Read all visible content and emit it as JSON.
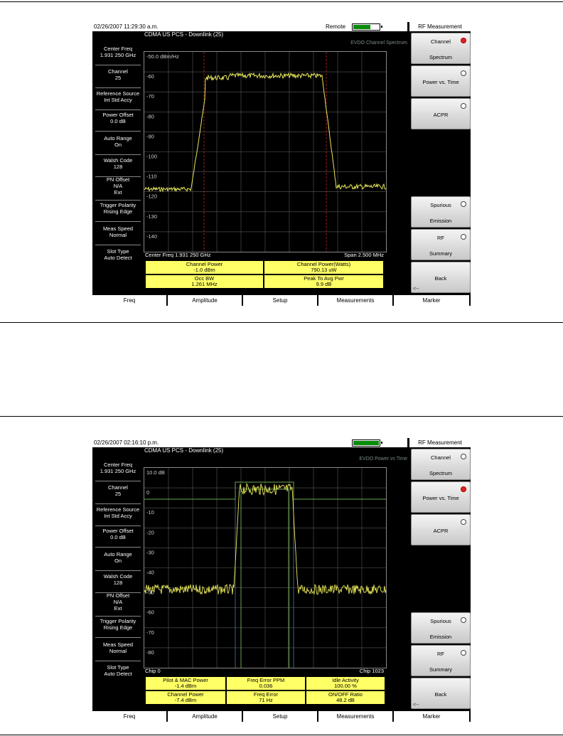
{
  "screens": [
    {
      "timestamp": "02/26/2007 11:29:30 a.m.",
      "remote_label": "Remote",
      "subtitle": "CDMA US PCS - Downlink (25)",
      "chart_title": "EVDO Channel Spectrum",
      "menu_title": "RF Measurement",
      "left_params": [
        {
          "name": "Center Freq",
          "value": "1.931 250 GHz"
        },
        {
          "name": "Channel",
          "value": "25"
        },
        {
          "name": "Reference Source",
          "value": "Int Std Accy"
        },
        {
          "name": "Power Offset",
          "value": "0.0 dB"
        },
        {
          "name": "Auto Range",
          "value": "On"
        },
        {
          "name": "Walsh Code",
          "value": "128"
        },
        {
          "name": "PN Offset",
          "value": "N/A",
          "extra": "Ext"
        },
        {
          "name": "Trigger Polarity",
          "value": "Rising Edge"
        },
        {
          "name": "Meas Speed",
          "value": "Normal"
        },
        {
          "name": "Slot Type",
          "value": "Auto Detect"
        }
      ],
      "softkeys": [
        {
          "line1": "Channel",
          "line2": "Spectrum",
          "selected": true
        },
        {
          "line1": "Power vs. Time",
          "line2": "",
          "selected": false
        },
        {
          "line1": "ACPR",
          "line2": "",
          "selected": false
        },
        {
          "line1": "Spurious",
          "line2": "Emission",
          "selected": false
        },
        {
          "line1": "RF",
          "line2": "Summary",
          "selected": false
        },
        {
          "line1": "Back",
          "line2": "",
          "selected": false
        }
      ],
      "y_labels": [
        "-50.0 dBm/Hz",
        "-60",
        "-70",
        "-80",
        "-90",
        "-100",
        "-110",
        "-120",
        "-130",
        "-140"
      ],
      "x_left": "Center Freq 1.931 250 GHz",
      "x_right": "Span 2.500 MHz",
      "results": [
        {
          "name": "Channel Power",
          "value": "-1.0 dBm"
        },
        {
          "name": "Channel Power(Watts)",
          "value": "790.13 uW"
        },
        {
          "name": "Occ BW",
          "value": "1.261 MHz"
        },
        {
          "name": "Peak To Avg Pwr",
          "value": "9.9 dB"
        }
      ],
      "bottom_tabs": [
        "Freq",
        "Amplitude",
        "Setup",
        "Measurements",
        "Marker"
      ]
    },
    {
      "timestamp": "02/26/2007 02:16:10 p.m.",
      "remote_label": "",
      "subtitle": "CDMA US PCS - Downlink (25)",
      "chart_title": "EVDO Power vs Time",
      "menu_title": "RF Measurement",
      "left_params": [
        {
          "name": "Center Freq",
          "value": "1.931 250 GHz"
        },
        {
          "name": "Channel",
          "value": "25"
        },
        {
          "name": "Reference Source",
          "value": "Int Std Accy"
        },
        {
          "name": "Power Offset",
          "value": "0.0 dB"
        },
        {
          "name": "Auto Range",
          "value": "On"
        },
        {
          "name": "Walsh Code",
          "value": "128"
        },
        {
          "name": "PN Offset",
          "value": "N/A",
          "extra": "Ext"
        },
        {
          "name": "Trigger Polarity",
          "value": "Rising Edge"
        },
        {
          "name": "Meas Speed",
          "value": "Normal"
        },
        {
          "name": "Slot Type",
          "value": "Auto Detect"
        }
      ],
      "softkeys": [
        {
          "line1": "Channel",
          "line2": "Spectrum",
          "selected": false
        },
        {
          "line1": "Power vs. Time",
          "line2": "",
          "selected": true
        },
        {
          "line1": "ACPR",
          "line2": "",
          "selected": false
        },
        {
          "line1": "Spurious",
          "line2": "Emission",
          "selected": false
        },
        {
          "line1": "RF",
          "line2": "Summary",
          "selected": false
        },
        {
          "line1": "Back",
          "line2": "",
          "selected": false
        }
      ],
      "y_labels": [
        "10.0 dB",
        "0",
        "-10",
        "-20",
        "-30",
        "-40",
        "-50",
        "-60",
        "-70",
        "-80"
      ],
      "x_left": "Chip   0",
      "x_right": "Chip 1023",
      "results": [
        {
          "name": "Pilot & MAC Power",
          "value": "-1.4 dBm"
        },
        {
          "name": "Freq Error PPM",
          "value": "0.036"
        },
        {
          "name": "Idle Activity",
          "value": "100.00 %"
        },
        {
          "name": "Channel Power",
          "value": "-7.4 dBm"
        },
        {
          "name": "Freq Error",
          "value": "71 Hz"
        },
        {
          "name": "ON/OFF Ratio",
          "value": "48.2 dB"
        }
      ],
      "bottom_tabs": [
        "Freq",
        "Amplitude",
        "Setup",
        "Measurements",
        "Marker"
      ]
    }
  ],
  "colors": {
    "trace": "#e8e85a",
    "mask": "#6aa84f",
    "grid": "#5a5a5a",
    "marker_line": "#cc2222",
    "result_bg": "#ffff66"
  },
  "battery_level": 0.65
}
